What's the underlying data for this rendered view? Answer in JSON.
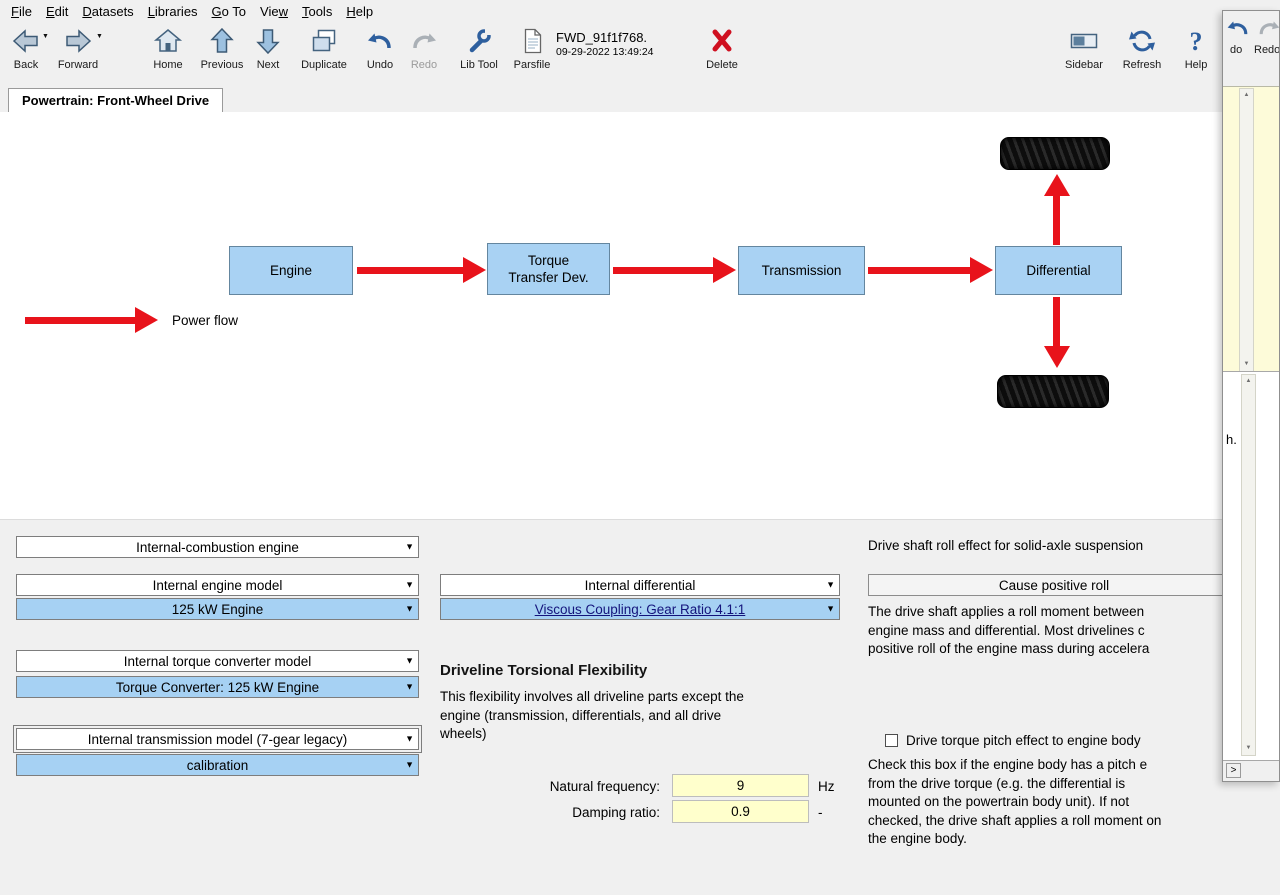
{
  "menu": {
    "items": [
      {
        "pre": "",
        "key": "F",
        "post": "ile"
      },
      {
        "pre": "",
        "key": "E",
        "post": "dit"
      },
      {
        "pre": "",
        "key": "D",
        "post": "atasets"
      },
      {
        "pre": "",
        "key": "L",
        "post": "ibraries"
      },
      {
        "pre": "",
        "key": "G",
        "post": "o To"
      },
      {
        "pre": "Vie",
        "key": "w",
        "post": ""
      },
      {
        "pre": "",
        "key": "T",
        "post": "ools"
      },
      {
        "pre": "",
        "key": "H",
        "post": "elp"
      }
    ]
  },
  "toolbar": {
    "back": "Back",
    "forward": "Forward",
    "home": "Home",
    "previous": "Previous",
    "next": "Next",
    "duplicate": "Duplicate",
    "undo": "Undo",
    "redo": "Redo",
    "lib_tool": "Lib Tool",
    "parsfile": "Parsfile",
    "delete": "Delete",
    "sidebar": "Sidebar",
    "refresh": "Refresh",
    "help": "Help",
    "dataset_name": "FWD_91f1f768.",
    "dataset_timestamp": "09-29-2022 13:49:24"
  },
  "tab": {
    "title": "Powertrain: Front-Wheel Drive"
  },
  "diagram": {
    "legend_label": "Power flow",
    "boxes": [
      {
        "label": "Engine"
      },
      {
        "label": "Torque\nTransfer Dev."
      },
      {
        "label": "Transmission"
      },
      {
        "label": "Differential"
      }
    ]
  },
  "powertrain_panel": {
    "engine_type": "Internal-combustion engine",
    "engine_model_category": "Internal engine model",
    "engine_model": "125 kW Engine",
    "torque_converter_category": "Internal torque converter model",
    "torque_converter": "Torque Converter: 125 kW Engine",
    "transmission_category": "Internal transmission model (7-gear legacy)",
    "transmission": "calibration"
  },
  "differential_panel": {
    "category": "Internal differential",
    "link": "Viscous Coupling: Gear Ratio 4.1:1"
  },
  "flexibility": {
    "heading": "Driveline Torsional Flexibility",
    "description": "This flexibility involves all driveline parts except the\nengine (transmission, differentials, and all drive\nwheels)",
    "natural_frequency_label": "Natural frequency:",
    "natural_frequency_value": "9",
    "natural_frequency_unit": "Hz",
    "damping_ratio_label": "Damping ratio:",
    "damping_ratio_value": "0.9",
    "damping_ratio_unit": "-"
  },
  "roll_effect": {
    "caption": "Drive shaft roll effect for solid-axle suspension",
    "button": "Cause positive roll",
    "description": "The drive shaft applies a roll moment between\nengine mass and differential.  Most drivelines c\npositive roll of the engine mass during accelera",
    "checkbox_label": "Drive torque pitch effect to engine body",
    "checkbox_checked": false,
    "checkbox_description": "Check this box if the engine body has a pitch e\nfrom the drive torque (e.g. the differential is\nmounted on the powertrain body unit). If not\nchecked, the drive shaft applies a roll moment on\nthe engine body."
  },
  "overlay": {
    "undo_partial": "do",
    "redo_label": "Redo",
    "notes_partial": "h. F",
    "scroll_right": ">"
  }
}
